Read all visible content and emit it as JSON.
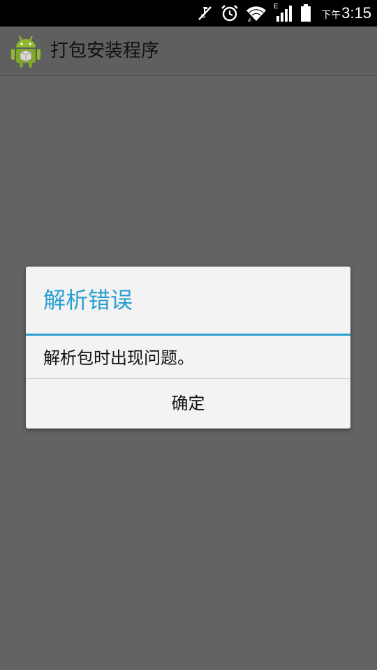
{
  "status_bar": {
    "icons": [
      "mute-icon",
      "alarm-icon",
      "wifi-icon",
      "signal-icon",
      "battery-icon"
    ],
    "network_label": "E",
    "ampm": "下午",
    "time": "3:15"
  },
  "app_bar": {
    "icon": "android-package-icon",
    "title": "打包安装程序"
  },
  "dialog": {
    "title": "解析错误",
    "message": "解析包时出现问题。",
    "ok_label": "确定",
    "accent_color": "#2a9fd0"
  }
}
